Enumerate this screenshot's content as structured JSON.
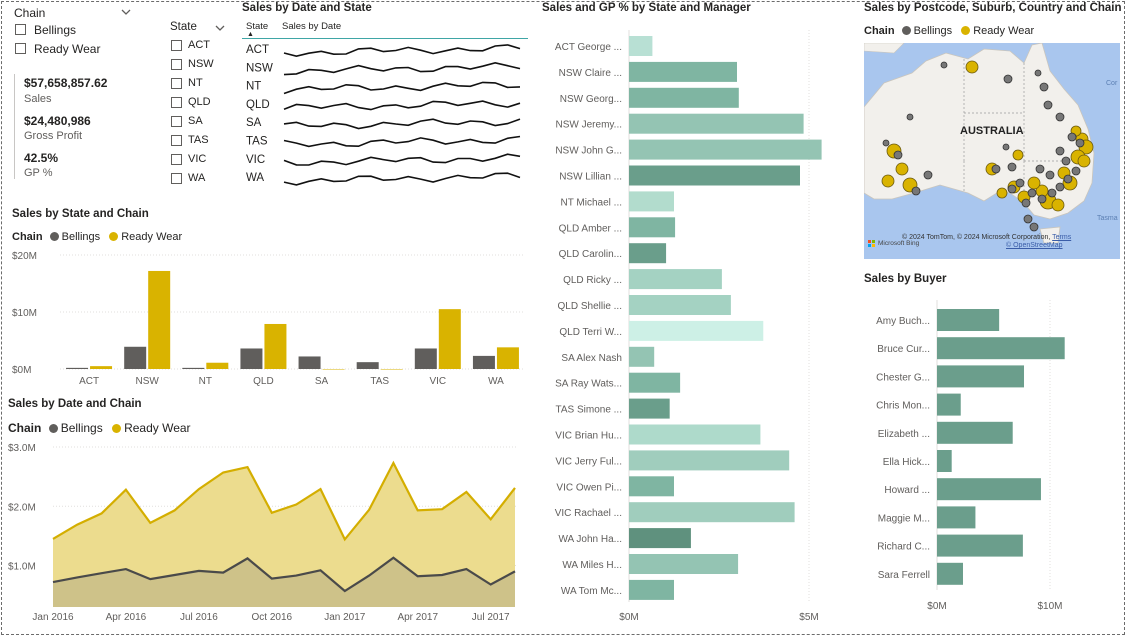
{
  "chain_slicer": {
    "title": "Chain",
    "options": [
      "Bellings",
      "Ready Wear"
    ]
  },
  "kpis": [
    {
      "value": "$57,658,857.62",
      "label": "Sales"
    },
    {
      "value": "$24,480,986",
      "label": "Gross Profit"
    },
    {
      "value": "42.5%",
      "label": "GP %"
    }
  ],
  "state_slicer": {
    "title": "State",
    "options": [
      "ACT",
      "NSW",
      "NT",
      "QLD",
      "SA",
      "TAS",
      "VIC",
      "WA"
    ]
  },
  "sparkline_table": {
    "title": "Sales by Date and State",
    "col_state": "State",
    "col_sales": "Sales by Date",
    "rows": [
      "ACT",
      "NSW",
      "NT",
      "QLD",
      "SA",
      "TAS",
      "VIC",
      "WA"
    ]
  },
  "legend": {
    "title": "Chain",
    "bellings": "Bellings",
    "readywear": "Ready Wear",
    "bellings_color": "#605e5c",
    "readywear_color": "#d9b300"
  },
  "chart_data": [
    {
      "type": "bar",
      "title": "Sales by State and Chain",
      "categories": [
        "ACT",
        "NSW",
        "NT",
        "QLD",
        "SA",
        "TAS",
        "VIC",
        "WA"
      ],
      "series": [
        {
          "name": "Bellings",
          "values": [
            0.2,
            3.9,
            0.2,
            3.6,
            2.2,
            1.2,
            3.6,
            2.3
          ]
        },
        {
          "name": "Ready Wear",
          "values": [
            0.5,
            17.2,
            1.1,
            7.9,
            0,
            0,
            10.5,
            3.8
          ]
        }
      ],
      "yticks": [
        "$20M",
        "$10M",
        "$0M"
      ],
      "ylim": [
        0,
        20
      ],
      "unit": "M"
    },
    {
      "type": "area",
      "title": "Sales by Date and Chain",
      "x": [
        "2016-01",
        "2016-02",
        "2016-03",
        "2016-04",
        "2016-05",
        "2016-06",
        "2016-07",
        "2016-08",
        "2016-09",
        "2016-10",
        "2016-11",
        "2016-12",
        "2017-01",
        "2017-02",
        "2017-03",
        "2017-04",
        "2017-05",
        "2017-06",
        "2017-07",
        "2017-08"
      ],
      "series": [
        {
          "name": "Bellings",
          "values": [
            0.72,
            0.8,
            0.87,
            0.94,
            0.77,
            0.84,
            0.91,
            0.88,
            1.12,
            0.78,
            0.83,
            0.92,
            0.57,
            0.83,
            1.13,
            0.82,
            0.84,
            0.94,
            0.68,
            0.9
          ]
        },
        {
          "name": "Ready Wear",
          "values": [
            1.45,
            1.69,
            1.88,
            2.28,
            1.72,
            1.93,
            2.29,
            2.57,
            2.66,
            1.89,
            2.03,
            2.29,
            1.44,
            1.94,
            2.73,
            1.93,
            1.95,
            2.24,
            1.78,
            2.31
          ]
        }
      ],
      "xticks": [
        "Jan 2016",
        "Apr 2016",
        "Jul 2016",
        "Oct 2016",
        "Jan 2017",
        "Apr 2017",
        "Jul 2017"
      ],
      "yticks": [
        "$3.0M",
        "$2.0M",
        "$1.0M"
      ],
      "ylim": [
        0.3,
        3.0
      ],
      "unit": "M"
    },
    {
      "type": "bar",
      "orientation": "horizontal",
      "title": "Sales and GP % by State and Manager",
      "categories": [
        "ACT George ...",
        "NSW Claire ...",
        "NSW Georg...",
        "NSW Jeremy...",
        "NSW John G...",
        "NSW Lillian ...",
        "NT Michael ...",
        "QLD Amber ...",
        "QLD Carolin...",
        "QLD Ricky ...",
        "QLD Shellie ...",
        "QLD Terri W...",
        "SA Alex Nash",
        "SA Ray Wats...",
        "TAS Simone ...",
        "VIC Brian Hu...",
        "VIC Jerry Ful...",
        "VIC Owen Pi...",
        "VIC Rachael ...",
        "WA John Ha...",
        "WA Miles H...",
        "WA Tom Mc..."
      ],
      "values": [
        0.65,
        3.0,
        3.05,
        4.85,
        5.35,
        4.75,
        1.25,
        1.28,
        1.03,
        2.58,
        2.83,
        3.73,
        0.7,
        1.42,
        1.13,
        3.65,
        4.45,
        1.25,
        4.6,
        1.72,
        3.03,
        1.25
      ],
      "colors": [
        "#b8e0d4",
        "#7fb5a2",
        "#7fb5a2",
        "#94c4b3",
        "#94c4b3",
        "#6a9e8b",
        "#b2dccd",
        "#7fb5a2",
        "#6a9e8b",
        "#a4d2c2",
        "#a4d2c2",
        "#cdf0e6",
        "#94c4b3",
        "#7fb5a2",
        "#6a9e8b",
        "#aedacb",
        "#a0cdbd",
        "#7fb5a2",
        "#a0cdbd",
        "#5f917e",
        "#94c4b3",
        "#7fb5a2"
      ],
      "xticks": [
        "$0M",
        "$5M"
      ],
      "xlim": [
        0,
        5
      ],
      "unit": "M"
    },
    {
      "type": "bar",
      "orientation": "horizontal",
      "title": "Sales by Buyer",
      "categories": [
        "Amy Buch...",
        "Bruce Cur...",
        "Chester G...",
        "Chris Mon...",
        "Elizabeth ...",
        "Ella Hick...",
        "Howard ...",
        "Maggie M...",
        "Richard C...",
        "Sara Ferrell"
      ],
      "values": [
        5.5,
        11.3,
        7.7,
        2.1,
        6.7,
        1.3,
        9.2,
        3.4,
        7.6,
        2.3
      ],
      "xticks": [
        "$0M",
        "$10M"
      ],
      "xlim": [
        0,
        10
      ],
      "unit": "M"
    }
  ],
  "map": {
    "title": "Sales by Postcode, Suburb, Country and Chain",
    "label_australia": "AUSTRALIA",
    "label_coral": "Cor",
    "label_tasman": "Tasma",
    "attribution": "© 2024 TomTom, © 2024 Microsoft Corporation,",
    "attribution_terms": "Terms",
    "attribution_osm": "© OpenStreetMap",
    "bing_label": "Microsoft Bing"
  }
}
